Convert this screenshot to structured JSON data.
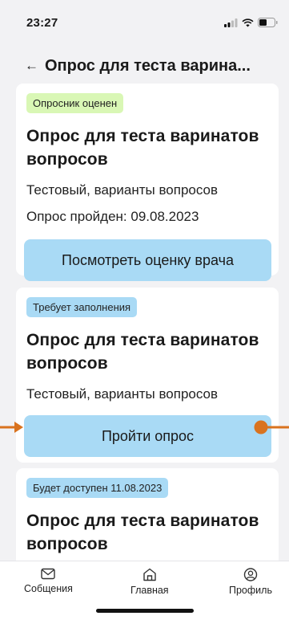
{
  "status_bar": {
    "time": "23:27"
  },
  "header": {
    "title": "Опрос для теста варина..."
  },
  "cards": [
    {
      "badge": "Опросник оценен",
      "badge_color": "#d9f7b5",
      "title": "Опрос для теста варинатов вопросов",
      "subtitle": "Тестовый, варианты вопросов",
      "completed": "Опрос пройден: 09.08.2023",
      "button": "Посмотреть оценку врача"
    },
    {
      "badge": "Требует заполнения",
      "badge_color": "#a9daf5",
      "title": "Опрос для теста варинатов вопросов",
      "subtitle": "Тестовый, варианты вопросов",
      "button": "Пройти опрос"
    },
    {
      "badge": "Будет доступен 11.08.2023",
      "badge_color": "#a9daf5",
      "title": "Опрос для теста варинатов вопросов"
    }
  ],
  "tabbar": {
    "messages": "Собщения",
    "home": "Главная",
    "profile": "Профиль"
  },
  "annotation_color": "#d9731f",
  "icons": [
    "back-arrow-icon",
    "signal-icon",
    "wifi-icon",
    "battery-icon",
    "mail-icon",
    "home-icon",
    "profile-icon"
  ]
}
